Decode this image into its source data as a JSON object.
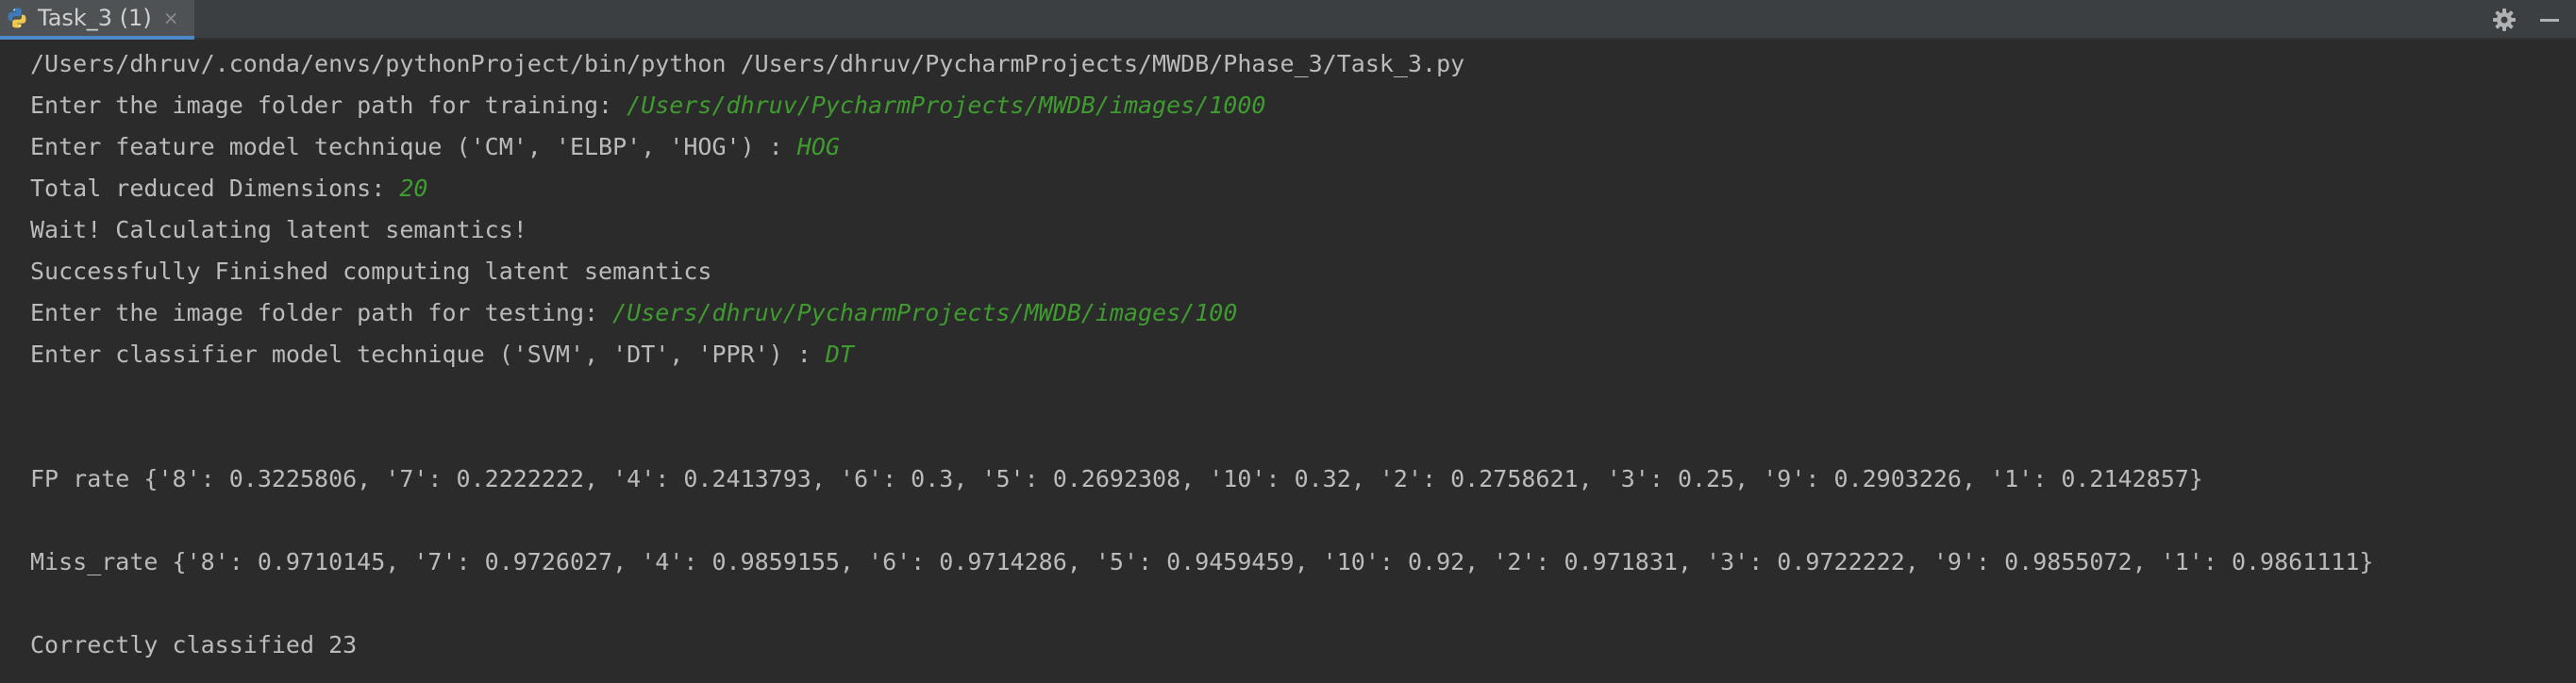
{
  "tab": {
    "title": "Task_3 (1)",
    "close": "×"
  },
  "console": {
    "command": "/Users/dhruv/.conda/envs/pythonProject/bin/python /Users/dhruv/PycharmProjects/MWDB/Phase_3/Task_3.py",
    "prompt_train": "Enter the image folder path for training: ",
    "input_train": "/Users/dhruv/PycharmProjects/MWDB/images/1000",
    "prompt_feature": "Enter feature model technique ('CM', 'ELBP', 'HOG') : ",
    "input_feature": "HOG",
    "prompt_dims": "Total reduced Dimensions: ",
    "input_dims": "20",
    "wait": "Wait! Calculating latent semantics!",
    "finished": "Successfully Finished computing latent semantics",
    "prompt_test": "Enter the image folder path for testing: ",
    "input_test": "/Users/dhruv/PycharmProjects/MWDB/images/100",
    "prompt_classifier": "Enter classifier model technique ('SVM', 'DT', 'PPR') : ",
    "input_classifier": "DT",
    "fp_rate": "FP rate {'8': 0.3225806, '7': 0.2222222, '4': 0.2413793, '6': 0.3, '5': 0.2692308, '10': 0.32, '2': 0.2758621, '3': 0.25, '9': 0.2903226, '1': 0.2142857}",
    "miss_rate": "Miss_rate {'8': 0.9710145, '7': 0.9726027, '4': 0.9859155, '6': 0.9714286, '5': 0.9459459, '10': 0.92, '2': 0.971831, '3': 0.9722222, '9': 0.9855072, '1': 0.9861111}",
    "correct": "Correctly classified 23"
  },
  "icons": {
    "tab": "python-icon",
    "settings": "gear-icon",
    "hide": "minimize-icon"
  },
  "colors": {
    "background": "#2b2b2b",
    "tabbar": "#3c3f41",
    "text": "#bbbbbb",
    "user_input": "#3f9b2f",
    "tab_underline": "#4a88c7"
  }
}
